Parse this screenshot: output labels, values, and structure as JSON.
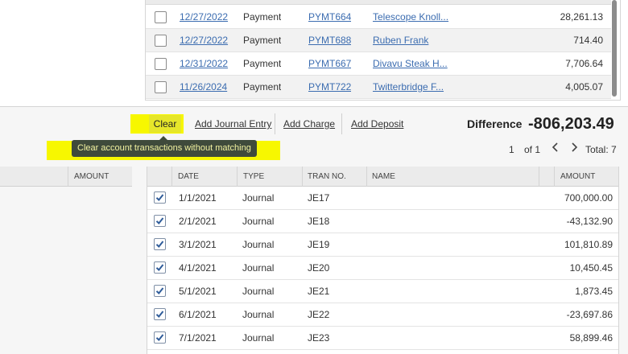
{
  "top_table": {
    "rows": [
      {
        "date": "12/27/2022",
        "type": "Payment",
        "tran_no": "PYMT664",
        "name": "Telescope Knoll...",
        "amount": "28,261.13"
      },
      {
        "date": "12/27/2022",
        "type": "Payment",
        "tran_no": "PYMT688",
        "name": "Ruben Frank",
        "amount": "714.40"
      },
      {
        "date": "12/31/2022",
        "type": "Payment",
        "tran_no": "PYMT667",
        "name": "Divavu Steak H...",
        "amount": "7,706.64"
      },
      {
        "date": "11/26/2024",
        "type": "Payment",
        "tran_no": "PYMT722",
        "name": "Twitterbridge F...",
        "amount": "4,005.07"
      }
    ]
  },
  "toolbar": {
    "clear_label": "Clear",
    "add_journal_label": "Add Journal Entry",
    "add_charge_label": "Add Charge",
    "add_deposit_label": "Add Deposit",
    "difference_label": "Difference",
    "difference_value": "-806,203.49",
    "tooltip": "Clear account transactions without matching"
  },
  "pager": {
    "page": "1",
    "of": "of 1",
    "total": "Total: 7",
    "prev_icon": "chevron-left-icon",
    "next_icon": "chevron-right-icon"
  },
  "left_table": {
    "amount_header": "AMOUNT"
  },
  "bottom_table": {
    "headers": {
      "date": "DATE",
      "type": "TYPE",
      "tran_no": "TRAN NO.",
      "name": "NAME",
      "amount": "AMOUNT"
    },
    "rows": [
      {
        "checked": true,
        "date": "1/1/2021",
        "type": "Journal",
        "tran_no": "JE17",
        "name": "",
        "amount": "700,000.00"
      },
      {
        "checked": true,
        "date": "2/1/2021",
        "type": "Journal",
        "tran_no": "JE18",
        "name": "",
        "amount": "-43,132.90"
      },
      {
        "checked": true,
        "date": "3/1/2021",
        "type": "Journal",
        "tran_no": "JE19",
        "name": "",
        "amount": "101,810.89"
      },
      {
        "checked": true,
        "date": "4/1/2021",
        "type": "Journal",
        "tran_no": "JE20",
        "name": "",
        "amount": "10,450.45"
      },
      {
        "checked": true,
        "date": "5/1/2021",
        "type": "Journal",
        "tran_no": "JE21",
        "name": "",
        "amount": "1,873.45"
      },
      {
        "checked": true,
        "date": "6/1/2021",
        "type": "Journal",
        "tran_no": "JE22",
        "name": "",
        "amount": "-23,697.86"
      },
      {
        "checked": true,
        "date": "7/1/2021",
        "type": "Journal",
        "tran_no": "JE23",
        "name": "",
        "amount": "58,899.46"
      }
    ]
  },
  "colors": {
    "highlight": "#f7f700",
    "link": "#3b6cb0",
    "tooltip_bg": "#3f4a3b",
    "checkbox_check": "#2f5c9a"
  }
}
